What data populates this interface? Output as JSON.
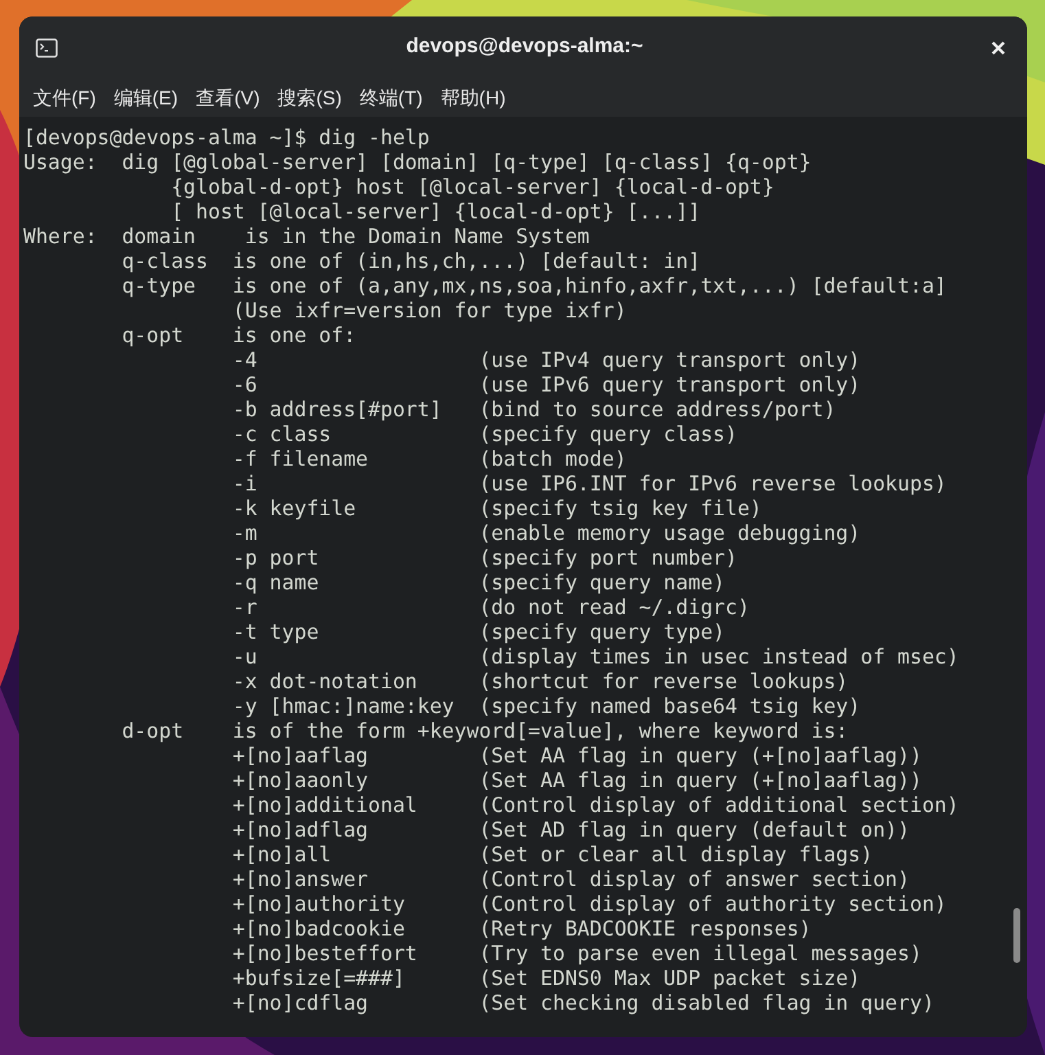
{
  "window": {
    "title": "devops@devops-alma:~"
  },
  "menu": [
    {
      "label": "文件(F)"
    },
    {
      "label": "编辑(E)"
    },
    {
      "label": "查看(V)"
    },
    {
      "label": "搜索(S)"
    },
    {
      "label": "终端(T)"
    },
    {
      "label": "帮助(H)"
    }
  ],
  "terminal": {
    "lines": [
      "[devops@devops-alma ~]$ dig -help",
      "Usage:  dig [@global-server] [domain] [q-type] [q-class] {q-opt}",
      "            {global-d-opt} host [@local-server] {local-d-opt}",
      "            [ host [@local-server] {local-d-opt} [...]]",
      "Where:  domain    is in the Domain Name System",
      "        q-class  is one of (in,hs,ch,...) [default: in]",
      "        q-type   is one of (a,any,mx,ns,soa,hinfo,axfr,txt,...) [default:a]",
      "                 (Use ixfr=version for type ixfr)",
      "        q-opt    is one of:",
      "                 -4                  (use IPv4 query transport only)",
      "                 -6                  (use IPv6 query transport only)",
      "                 -b address[#port]   (bind to source address/port)",
      "                 -c class            (specify query class)",
      "                 -f filename         (batch mode)",
      "                 -i                  (use IP6.INT for IPv6 reverse lookups)",
      "                 -k keyfile          (specify tsig key file)",
      "                 -m                  (enable memory usage debugging)",
      "                 -p port             (specify port number)",
      "                 -q name             (specify query name)",
      "                 -r                  (do not read ~/.digrc)",
      "                 -t type             (specify query type)",
      "                 -u                  (display times in usec instead of msec)",
      "                 -x dot-notation     (shortcut for reverse lookups)",
      "                 -y [hmac:]name:key  (specify named base64 tsig key)",
      "        d-opt    is of the form +keyword[=value], where keyword is:",
      "                 +[no]aaflag         (Set AA flag in query (+[no]aaflag))",
      "                 +[no]aaonly         (Set AA flag in query (+[no]aaflag))",
      "                 +[no]additional     (Control display of additional section)",
      "                 +[no]adflag         (Set AD flag in query (default on))",
      "                 +[no]all            (Set or clear all display flags)",
      "                 +[no]answer         (Control display of answer section)",
      "                 +[no]authority      (Control display of authority section)",
      "                 +[no]badcookie      (Retry BADCOOKIE responses)",
      "                 +[no]besteffort     (Try to parse even illegal messages)",
      "                 +bufsize[=###]      (Set EDNS0 Max UDP packet size)",
      "                 +[no]cdflag         (Set checking disabled flag in query)"
    ]
  }
}
